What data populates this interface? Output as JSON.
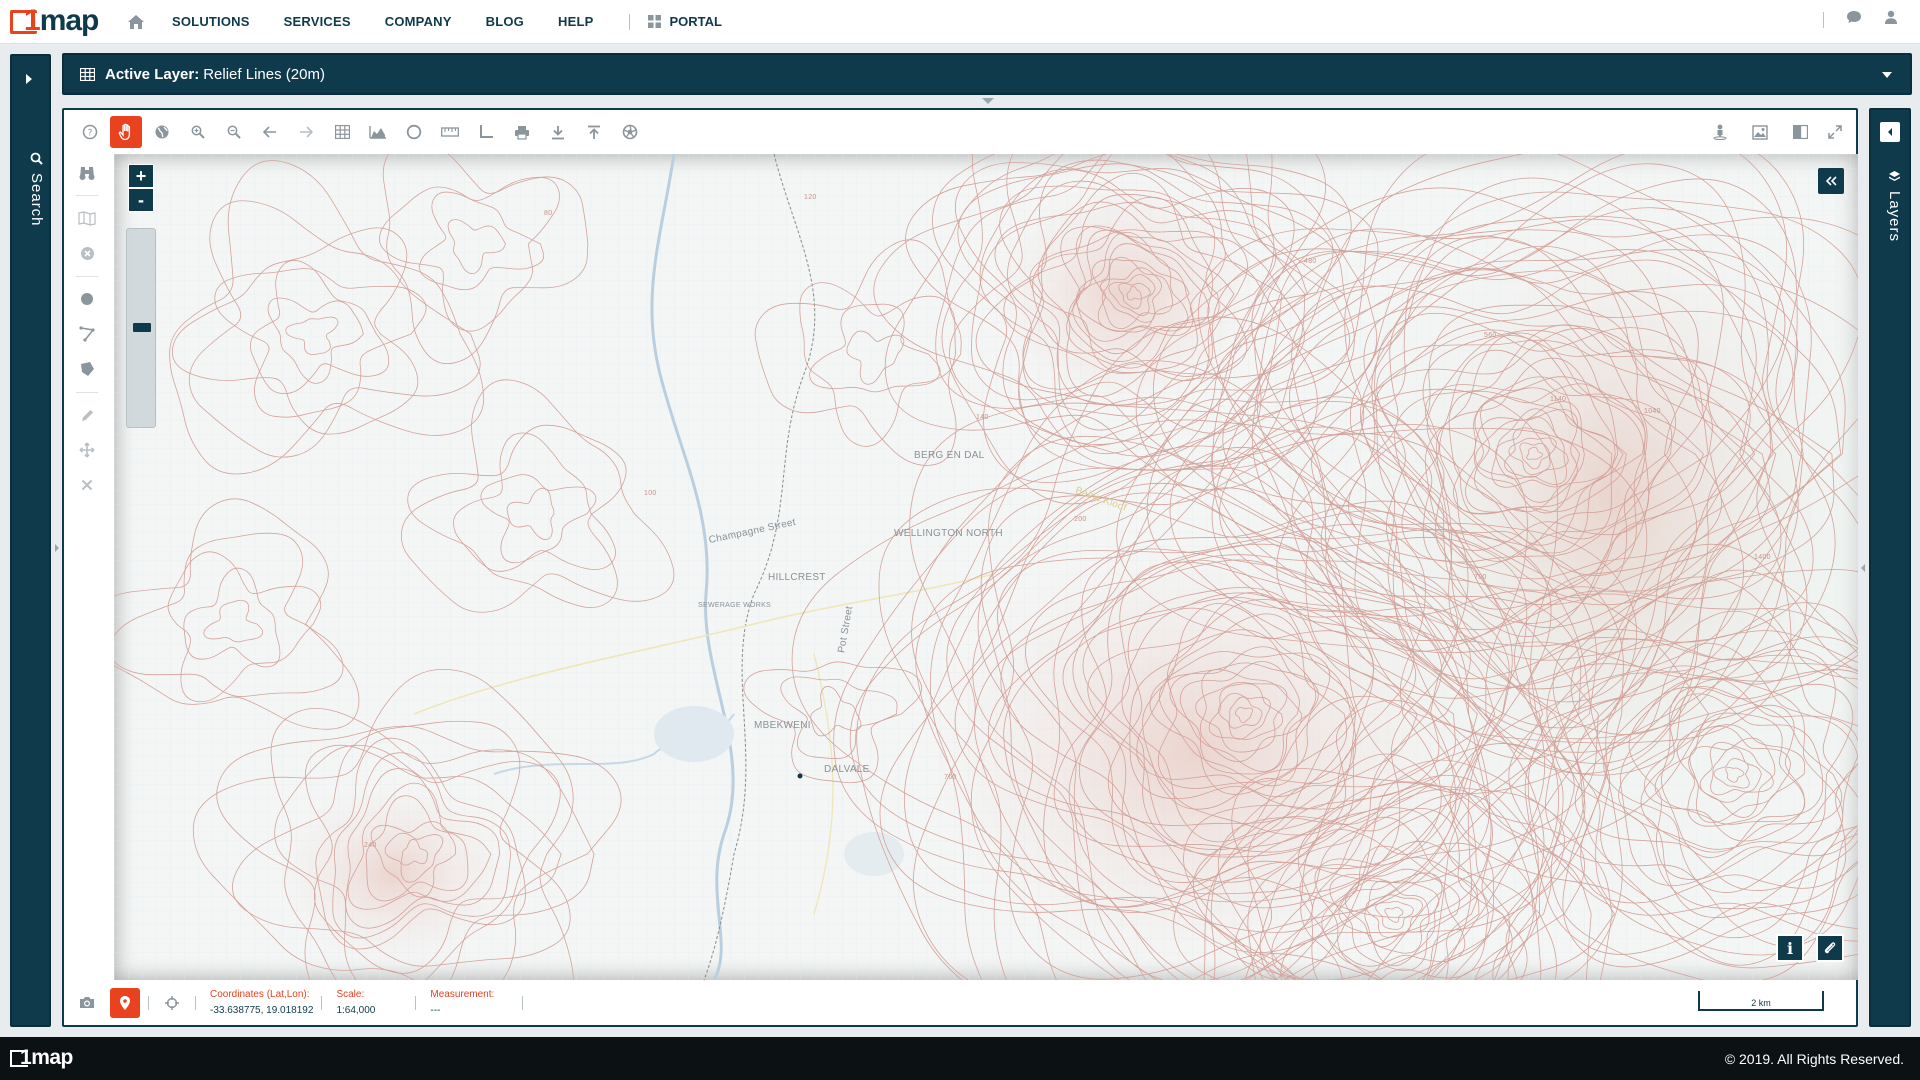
{
  "brand": {
    "logo_mark": "1",
    "logo_text": "map"
  },
  "nav": {
    "items": [
      "SOLUTIONS",
      "SERVICES",
      "COMPANY",
      "BLOG",
      "HELP"
    ],
    "portal": "PORTAL"
  },
  "left_panel": {
    "label": "Search"
  },
  "right_panel": {
    "label": "Layers"
  },
  "active_layer": {
    "label": "Active Layer:",
    "value": "Relief Lines (20m)"
  },
  "map": {
    "places": [
      {
        "name": "BERG EN DAL"
      },
      {
        "name": "WELLINGTON NORTH"
      },
      {
        "name": "HILLCREST"
      },
      {
        "name": "SEWERAGE WORKS"
      },
      {
        "name": "MBEKWENI"
      },
      {
        "name": "DALVALE"
      },
      {
        "name": "Champagne Street"
      },
      {
        "name": "Pot Street"
      },
      {
        "name": "Bains Kloof"
      }
    ],
    "contour_labels": [
      "80",
      "100",
      "120",
      "140",
      "200",
      "240",
      "480",
      "560",
      "700",
      "760",
      "1040",
      "1140",
      "1400"
    ]
  },
  "status": {
    "coordinates_label": "Coordinates (Lat,Lon):",
    "coordinates_value": "-33.638775, 19.018192",
    "scale_label": "Scale:",
    "scale_value": "1:64,000",
    "measurement_label": "Measurement:",
    "measurement_value": "---",
    "scalebar": "2 km"
  },
  "footer": {
    "copyright": "© 2019. All Rights Reserved."
  },
  "colors": {
    "brand_dark": "#0f3a4c",
    "accent": "#e8421f",
    "contour": "#d4a29a",
    "water": "#b9cfe0"
  }
}
